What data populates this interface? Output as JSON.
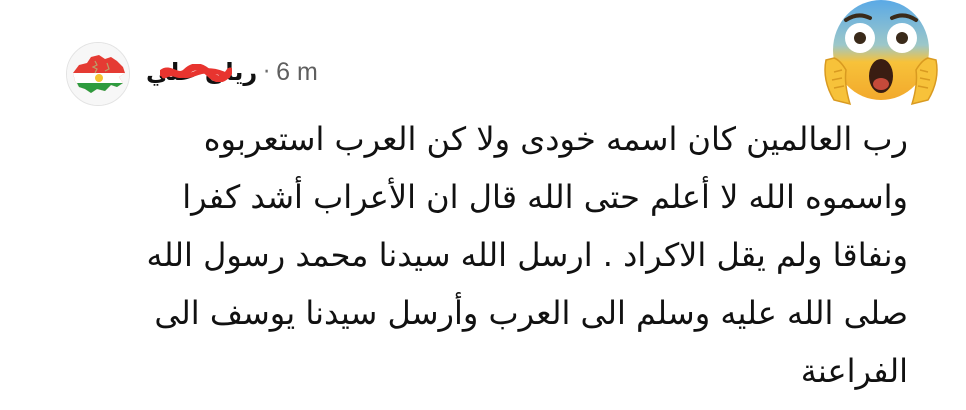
{
  "comment": {
    "author": "ريان علي",
    "separator": "·",
    "timestamp": "6 m",
    "avatar_icon": "kurdistan-map-flag-icon",
    "reaction_icon": "screaming-in-fear-face-emoji",
    "lines": [
      "رب العالمين كان اسمه خودى ولا كن العرب استعربوه",
      "واسموه الله لا أعلم حتى الله قال ان الأعراب أشد كفرا",
      "ونفاقا ولم يقل الاكراد . ارسل الله سيدنا محمد رسول الله",
      "صلى الله عليه وسلم الى العرب وأرسل سيدنا يوسف الى",
      "الفراعنة"
    ]
  },
  "colors": {
    "background": "#ffffff",
    "text": "#111111",
    "meta": "#5f5f5f",
    "redaction": "#e8342f",
    "emoji_face": "#f7c23a",
    "emoji_top": "#5aa9e6"
  }
}
